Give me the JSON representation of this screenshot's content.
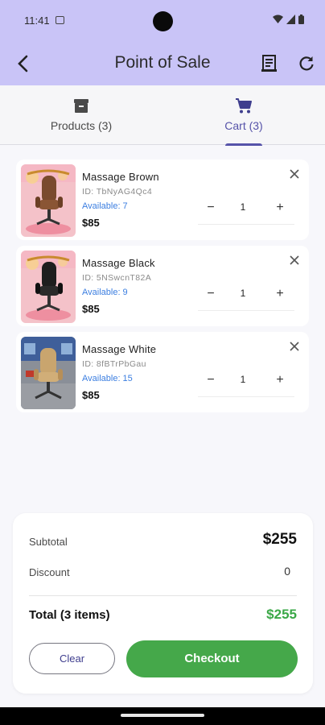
{
  "status_bar": {
    "time": "11:41"
  },
  "app_bar": {
    "title": "Point of Sale"
  },
  "tabs": [
    {
      "label": "Products (3)",
      "icon": "archive-box-icon"
    },
    {
      "label": "Cart (3)",
      "icon": "cart-icon",
      "selected": true
    }
  ],
  "cart": {
    "items": [
      {
        "name": "Massage Brown",
        "id": "ID: TbNyAG4Qc4",
        "available": "Available: 7",
        "price": "$85",
        "qty": "1",
        "minus": "−",
        "plus": "+"
      },
      {
        "name": "Massage Black",
        "id": "ID: 5NSwcnT82A",
        "available": "Available: 9",
        "price": "$85",
        "qty": "1",
        "minus": "−",
        "plus": "+"
      },
      {
        "name": "Massage White",
        "id": "ID: 8fBTrPbGau",
        "available": "Available: 15",
        "price": "$85",
        "qty": "1",
        "minus": "−",
        "plus": "+"
      }
    ]
  },
  "summary": {
    "subtotal_label": "Subtotal",
    "subtotal_value": "$255",
    "discount_label": "Discount",
    "discount_value": "0",
    "total_label": "Total (3 items)",
    "total_value": "$255",
    "clear_label": "Clear",
    "checkout_label": "Checkout"
  },
  "colors": {
    "app_bar": "#c9c4f7",
    "accent": "#5653a9",
    "available": "#3b7ee0",
    "total": "#3aa847",
    "checkout": "#45a84a"
  }
}
